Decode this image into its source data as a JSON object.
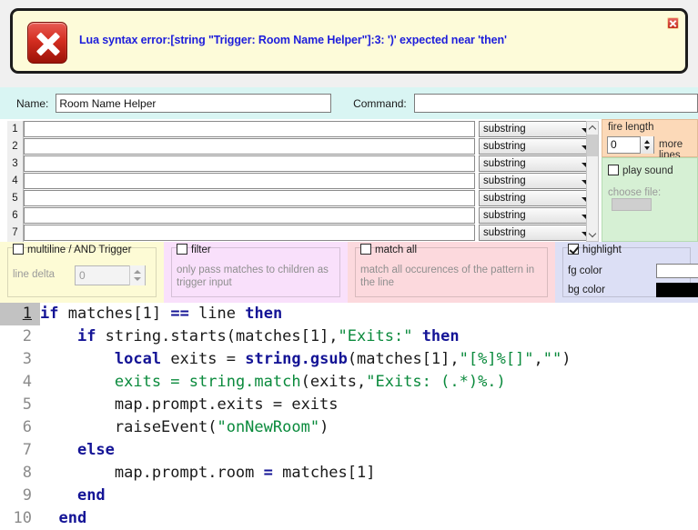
{
  "error": {
    "message": "Lua syntax error:[string \"Trigger: Room Name Helper\"]:3: ')' expected near 'then'",
    "icon": "error-x-icon",
    "close_icon": "close-icon"
  },
  "form": {
    "name_label": "Name:",
    "name_value": "Room Name Helper",
    "command_label": "Command:",
    "command_value": ""
  },
  "patterns": {
    "rows": [
      {
        "num": "1",
        "value": "",
        "type": "substring"
      },
      {
        "num": "2",
        "value": "",
        "type": "substring"
      },
      {
        "num": "3",
        "value": "",
        "type": "substring"
      },
      {
        "num": "4",
        "value": "",
        "type": "substring"
      },
      {
        "num": "5",
        "value": "",
        "type": "substring"
      },
      {
        "num": "6",
        "value": "",
        "type": "substring"
      },
      {
        "num": "7",
        "value": "",
        "type": "substring"
      }
    ]
  },
  "fire": {
    "title": "fire length",
    "value": "0",
    "more_lines_label": "more lines"
  },
  "sound": {
    "play_sound_label": "play sound",
    "play_sound_checked": false,
    "choose_file_label": "choose file:",
    "choose_file_value": ""
  },
  "options": {
    "multiline": {
      "label": "multiline / AND Trigger",
      "checked": false,
      "line_delta_label": "line delta",
      "line_delta_value": "0"
    },
    "filter": {
      "label": "filter",
      "checked": false,
      "description": "only pass matches to children as trigger input"
    },
    "match_all": {
      "label": "match all",
      "checked": false,
      "description": "match all occurences of the pattern in the line"
    },
    "highlight": {
      "label": "highlight",
      "checked": true,
      "fg_label": "fg color",
      "bg_label": "bg color",
      "fg_color": "#ffffff",
      "bg_color": "#000000"
    }
  },
  "editor": {
    "current_line": 1,
    "lines": [
      {
        "num": "1",
        "tokens": [
          {
            "t": "if ",
            "c": "kw"
          },
          {
            "t": "matches[",
            "c": "op"
          },
          {
            "t": "1",
            "c": "op"
          },
          {
            "t": "] ",
            "c": "op"
          },
          {
            "t": "== ",
            "c": "kw"
          },
          {
            "t": "line ",
            "c": "op"
          },
          {
            "t": "then",
            "c": "kw"
          }
        ]
      },
      {
        "num": "2",
        "tokens": [
          {
            "t": "    ",
            "c": "op"
          },
          {
            "t": "if ",
            "c": "kw"
          },
          {
            "t": "string.starts(matches[1],",
            "c": "op"
          },
          {
            "t": "\"Exits:\"",
            "c": "str"
          },
          {
            "t": " ",
            "c": "op"
          },
          {
            "t": "then",
            "c": "kw"
          }
        ]
      },
      {
        "num": "3",
        "tokens": [
          {
            "t": "        ",
            "c": "op"
          },
          {
            "t": "local ",
            "c": "kw"
          },
          {
            "t": "exits ",
            "c": "op"
          },
          {
            "t": "= ",
            "c": "op"
          },
          {
            "t": "string.gsub",
            "c": "fn"
          },
          {
            "t": "(matches[1],",
            "c": "op"
          },
          {
            "t": "\"[%]%[]\"",
            "c": "str"
          },
          {
            "t": ",",
            "c": "op"
          },
          {
            "t": "\"\"",
            "c": "str"
          },
          {
            "t": ")",
            "c": "op"
          }
        ]
      },
      {
        "num": "4",
        "tokens": [
          {
            "t": "        ",
            "c": "op"
          },
          {
            "t": "exits = string.match",
            "c": "str"
          },
          {
            "t": "(exits,",
            "c": "op"
          },
          {
            "t": "\"Exits: (.*)%.)",
            "c": "str"
          }
        ]
      },
      {
        "num": "5",
        "tokens": [
          {
            "t": "        map.prompt.exits = exits",
            "c": "op"
          }
        ]
      },
      {
        "num": "6",
        "tokens": [
          {
            "t": "        raiseEvent(",
            "c": "op"
          },
          {
            "t": "\"onNewRoom\"",
            "c": "str"
          },
          {
            "t": ")",
            "c": "op"
          }
        ]
      },
      {
        "num": "7",
        "tokens": [
          {
            "t": "    ",
            "c": "op"
          },
          {
            "t": "else",
            "c": "kw"
          }
        ]
      },
      {
        "num": "8",
        "tokens": [
          {
            "t": "        map.prompt.room ",
            "c": "op"
          },
          {
            "t": "= ",
            "c": "kw"
          },
          {
            "t": "matches[1]",
            "c": "op"
          }
        ]
      },
      {
        "num": "9",
        "tokens": [
          {
            "t": "    ",
            "c": "op"
          },
          {
            "t": "end",
            "c": "kw"
          }
        ]
      },
      {
        "num": "10",
        "tokens": [
          {
            "t": "  ",
            "c": "op"
          },
          {
            "t": "end",
            "c": "kw"
          }
        ]
      }
    ]
  }
}
